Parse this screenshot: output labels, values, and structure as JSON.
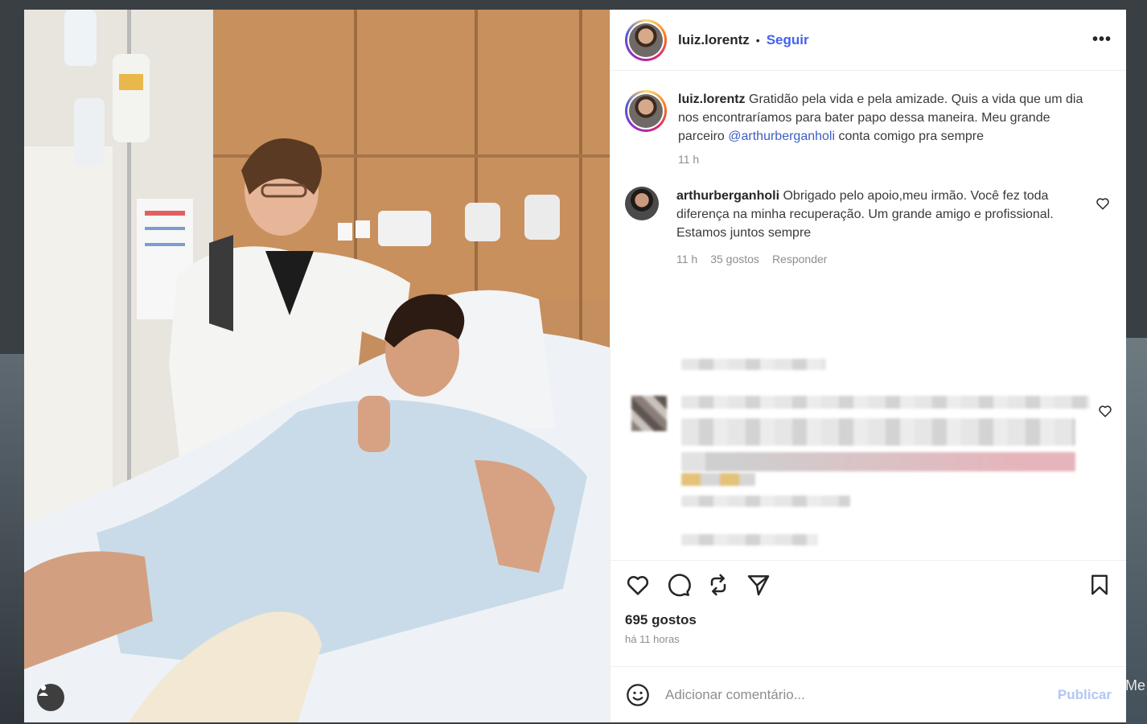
{
  "post": {
    "username": "luiz.lorentz",
    "separator": "•",
    "follow_label": "Seguir",
    "more_label": "•••"
  },
  "caption": {
    "username": "luiz.lorentz",
    "text_before": "Gratidão pela vida e pela amizade. Quis a vida que um dia nos encontraríamos para bater papo dessa maneira. Meu grande parceiro",
    "mention": "@arthurberganholi",
    "text_after": "conta comigo pra sempre",
    "time": "11 h"
  },
  "comments": [
    {
      "username": "arthurberganholi",
      "text": "Obrigado pelo apoio,meu irmão. Você fez toda diferença na minha recuperação. Um grande amigo e profissional. Estamos juntos sempre",
      "time": "11 h",
      "likes": "35 gostos",
      "reply_label": "Responder"
    }
  ],
  "footer": {
    "likes": "695 gostos",
    "posted": "há 11 horas",
    "comment_placeholder": "Adicionar comentário...",
    "publish_label": "Publicar"
  },
  "background": {
    "right_edge_text": "Me"
  },
  "icons": {
    "like": "heart-icon",
    "comment": "comment-icon",
    "repost": "repost-icon",
    "share": "send-icon",
    "save": "bookmark-icon",
    "emoji": "emoji-icon",
    "more": "more-icon",
    "tagged_user": "user-tag-icon"
  },
  "colors": {
    "follow": "#4162f0",
    "mention": "#3d5ec4",
    "publish_disabled": "#b2c6f7",
    "muted": "#8e8e8e"
  }
}
